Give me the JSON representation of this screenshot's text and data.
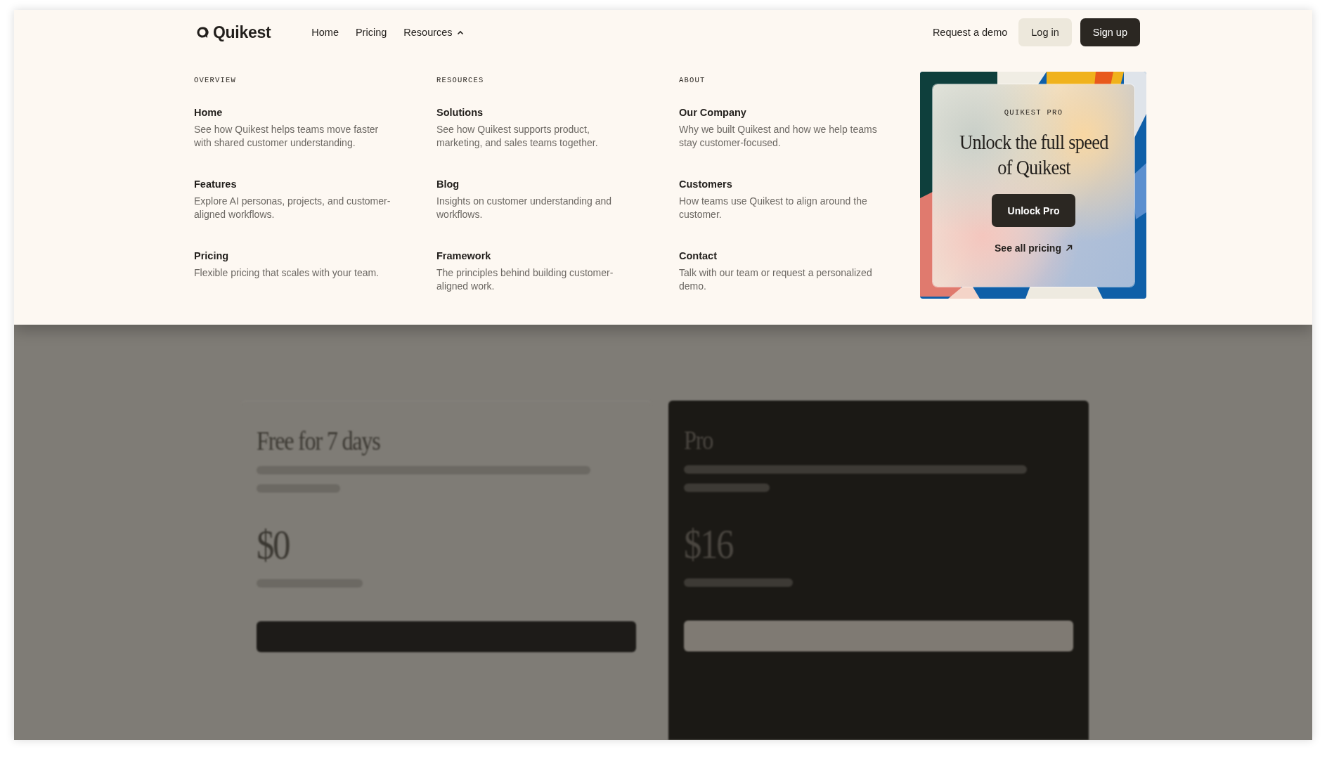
{
  "header": {
    "logo": "Quikest",
    "nav": [
      {
        "label": "Home",
        "kind": "link"
      },
      {
        "label": "Pricing",
        "kind": "link"
      },
      {
        "label": "Resources",
        "kind": "dropdown",
        "expanded": true
      }
    ],
    "actions": [
      {
        "label": "Request a demo",
        "kind": "link"
      },
      {
        "label": "Log in",
        "kind": "secondary"
      },
      {
        "label": "Sign up",
        "kind": "primary"
      }
    ]
  },
  "menu": {
    "columns": [
      {
        "heading": "OVERVIEW",
        "items": [
          {
            "title": "Home",
            "description": "See how Quikest helps teams move faster with shared customer understanding."
          },
          {
            "title": "Features",
            "description": "Explore AI personas, projects, and customer-aligned workflows."
          },
          {
            "title": "Pricing",
            "description": "Flexible pricing that scales with your team."
          }
        ]
      },
      {
        "heading": "RESOURCES",
        "items": [
          {
            "title": "Solutions",
            "description": "See how Quikest supports product, marketing, and sales teams together."
          },
          {
            "title": "Blog",
            "description": "Insights on customer understanding and workflows."
          },
          {
            "title": "Framework",
            "description": "The principles behind building customer-aligned work."
          }
        ]
      },
      {
        "heading": "ABOUT",
        "items": [
          {
            "title": "Our Company",
            "description": "Why we built Quikest and how we help teams stay customer-focused."
          },
          {
            "title": "Customers",
            "description": "How teams use Quikest to align around the customer."
          },
          {
            "title": "Contact",
            "description": "Talk with our team or request a personalized demo."
          }
        ]
      }
    ],
    "promo": {
      "kind": "picture",
      "eyebrow": "QUIKEST PRO",
      "title": "Unlock the full speed of Quikest",
      "button": "Unlock Pro",
      "link": "See all pricing"
    }
  },
  "plans": [
    {
      "kind": "light",
      "title": "Free for 7 days",
      "price": "$0"
    },
    {
      "kind": "dark",
      "title": "Pro",
      "price": "$16"
    }
  ]
}
